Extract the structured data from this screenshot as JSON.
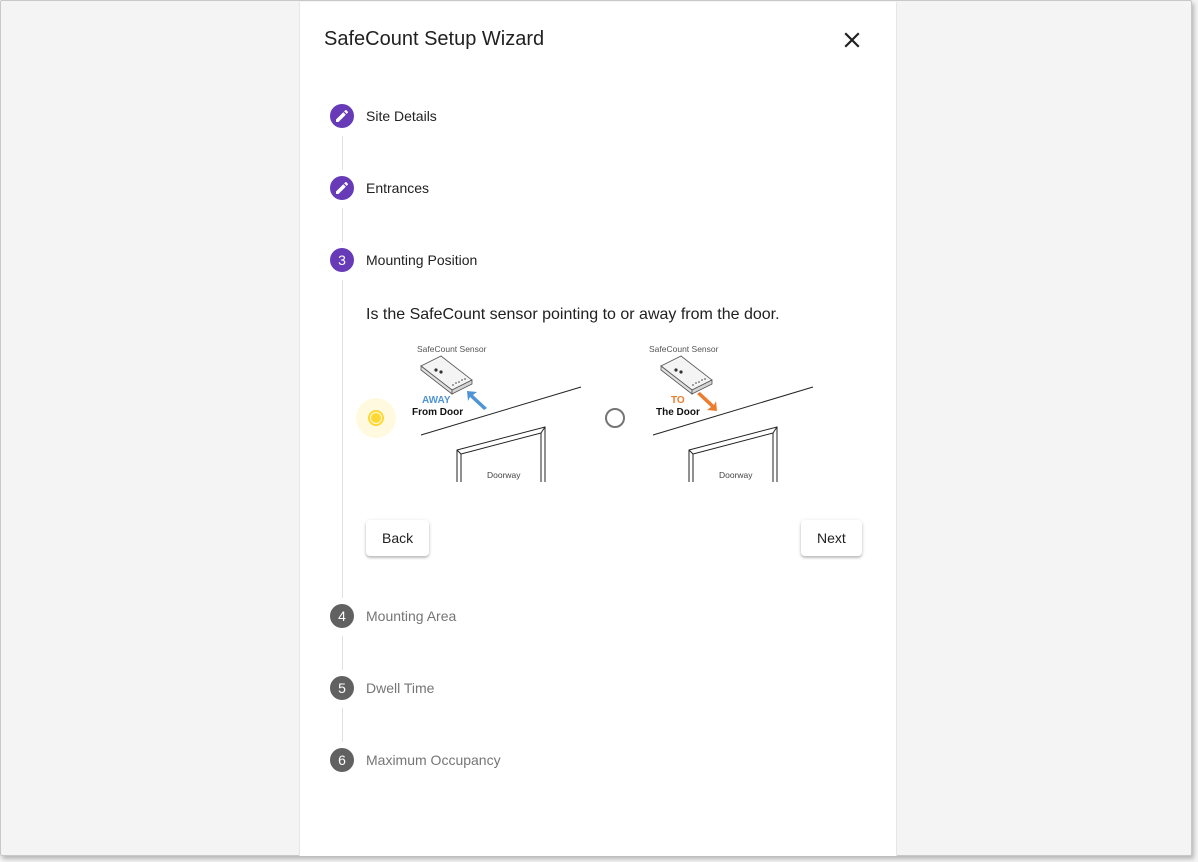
{
  "dialog": {
    "title": "SafeCount Setup Wizard"
  },
  "steps": [
    {
      "label": "Site Details",
      "state": "edit",
      "icon": "pencil-icon"
    },
    {
      "label": "Entrances",
      "state": "edit",
      "icon": "pencil-icon"
    },
    {
      "label": "Mounting Position",
      "number": "3",
      "state": "active"
    },
    {
      "label": "Mounting Area",
      "number": "4",
      "state": "inactive"
    },
    {
      "label": "Dwell Time",
      "number": "5",
      "state": "inactive"
    },
    {
      "label": "Maximum Occupancy",
      "number": "6",
      "state": "inactive"
    }
  ],
  "mounting_position": {
    "question": "Is the SafeCount sensor pointing to or away from the door.",
    "options": [
      {
        "selected": true,
        "sensor_label": "SafeCount Sensor",
        "direction_word": "AWAY",
        "direction_sub": "From Door",
        "door_label": "Doorway",
        "arrow_color": "#4f94d4"
      },
      {
        "selected": false,
        "sensor_label": "SafeCount Sensor",
        "direction_word": "TO",
        "direction_sub": "The Door",
        "door_label": "Doorway",
        "arrow_color": "#ec7c2e"
      }
    ],
    "back_label": "Back",
    "next_label": "Next"
  },
  "colors": {
    "accent": "#673ab7",
    "inactive_step": "#616161",
    "radio_selected": "#fdd835",
    "radio_unselected": "#757575"
  }
}
